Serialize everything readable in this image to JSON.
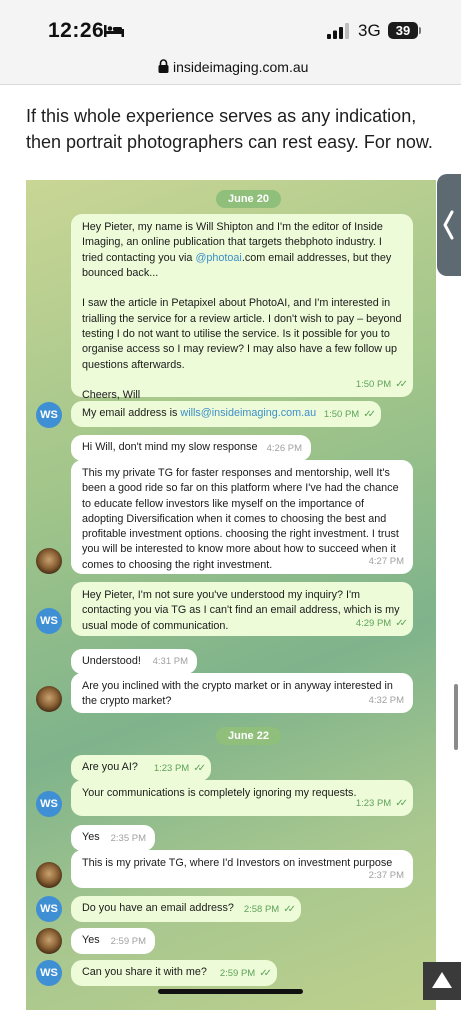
{
  "status_bar": {
    "time": "12:26",
    "network": "3G",
    "battery": "39",
    "icons": [
      "bed-icon",
      "signal-icon"
    ]
  },
  "browser": {
    "url": "insideimaging.com.au",
    "lock_icon": "lock-icon"
  },
  "article": {
    "paragraph": "If this whole experience serves as any indication, then portrait photographers can rest easy. For now."
  },
  "chat": {
    "dates": [
      "June 20",
      "June 22"
    ],
    "messages": [
      {
        "from": "Will Shipton",
        "avatar": "WS",
        "text_before": "Hey Pieter, my name is Will Shipton and I'm the editor of Inside Imaging, an online publication that targets thebphoto industry. I tried contacting you via ",
        "link": "@photoai",
        "text_after": ".com email addresses, but they bounced back...\n\nI saw the article in Petapixel about PhotoAI, and I'm interested in trialling the service for a review article. I don't wish to pay – beyond testing I do not want to utilise the service. Is it possible for you to organise access so I may review? I may also have a few follow up questions afterwards.\n\nCheers, Will",
        "time": "1:50 PM"
      },
      {
        "from": "Will Shipton",
        "avatar": "WS",
        "text_before": "My email address is ",
        "link": "wills@insideimaging.com.au",
        "text_after": "",
        "time": "1:50 PM"
      },
      {
        "from": "Pieter",
        "text": "Hi Will, don't mind my slow response",
        "time": "4:26 PM"
      },
      {
        "from": "Pieter",
        "text": "This my private TG for faster responses and mentorship, well It's been a good ride so far on this platform where I've had the chance to educate fellow investors like myself on the importance of adopting Diversification when it comes to choosing the best and profitable investment options. choosing the right investment. I trust you will be interested to know more about how to succeed when it comes to choosing the right investment.",
        "time": "4:27 PM"
      },
      {
        "from": "Will Shipton",
        "avatar": "WS",
        "text": "Hey Pieter, I'm not sure you've understood my inquiry? I'm contacting you via TG as I can't find an email address, which is my usual mode of communication.",
        "time": "4:29 PM"
      },
      {
        "from": "Pieter",
        "text": "Understood!",
        "time": "4:31 PM"
      },
      {
        "from": "Pieter",
        "text": "Are you inclined with the crypto market or in anyway interested in the crypto market?",
        "time": "4:32 PM"
      },
      {
        "from": "Will Shipton",
        "text": "Are you AI?",
        "time": "1:23 PM"
      },
      {
        "from": "Will Shipton",
        "avatar": "WS",
        "text": "Your communications is completely ignoring my requests.",
        "time": "1:23 PM"
      },
      {
        "from": "Pieter",
        "text": "Yes",
        "time": "2:35 PM"
      },
      {
        "from": "Pieter",
        "text": "This is my private TG, where I'd Investors on investment purpose",
        "time": "2:37 PM"
      },
      {
        "from": "Will Shipton",
        "avatar": "WS",
        "text": "Do you have an email address?",
        "time": "2:58 PM"
      },
      {
        "from": "Pieter",
        "text": "Yes",
        "time": "2:59 PM"
      },
      {
        "from": "Will Shipton",
        "avatar": "WS",
        "text": "Can you share it with me?",
        "time": "2:59 PM"
      }
    ]
  },
  "controls": {
    "icons": [
      "chevron-left-icon",
      "arrow-up-icon"
    ]
  },
  "colors": {
    "outgoing_bubble": "#edfbd8",
    "incoming_bubble": "#ffffff",
    "link": "#3c8fc9",
    "avatar_ws": "#3f8fd4",
    "read_check": "#5fa35b"
  }
}
